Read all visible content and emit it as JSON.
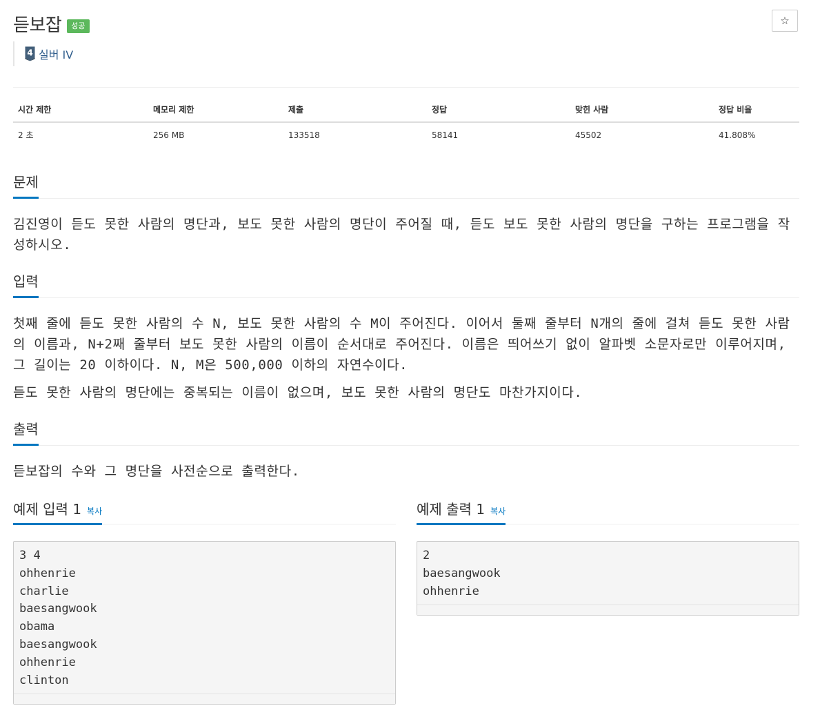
{
  "problem": {
    "title": "듣보잡",
    "status_badge": "성공",
    "tier_label": "실버 IV",
    "tier_number": "4"
  },
  "info_table": {
    "headers": [
      "시간 제한",
      "메모리 제한",
      "제출",
      "정답",
      "맞힌 사람",
      "정답 비율"
    ],
    "values": [
      "2 초",
      "256 MB",
      "133518",
      "58141",
      "45502",
      "41.808%"
    ]
  },
  "sections": {
    "problem": {
      "heading": "문제",
      "paragraphs": [
        "김진영이 듣도 못한 사람의 명단과, 보도 못한 사람의 명단이 주어질 때, 듣도 보도 못한 사람의 명단을 구하는 프로그램을 작성하시오."
      ]
    },
    "input": {
      "heading": "입력",
      "paragraphs": [
        "첫째 줄에 듣도 못한 사람의 수 N, 보도 못한 사람의 수 M이 주어진다. 이어서 둘째 줄부터 N개의 줄에 걸쳐 듣도 못한 사람의 이름과, N+2째 줄부터 보도 못한 사람의 이름이 순서대로 주어진다. 이름은 띄어쓰기 없이 알파벳 소문자로만 이루어지며, 그 길이는 20 이하이다. N, M은 500,000 이하의 자연수이다.",
        "듣도 못한 사람의 명단에는 중복되는 이름이 없으며, 보도 못한 사람의 명단도 마찬가지이다."
      ]
    },
    "output": {
      "heading": "출력",
      "paragraphs": [
        "듣보잡의 수와 그 명단을 사전순으로 출력한다."
      ]
    }
  },
  "samples": {
    "input": {
      "heading": "예제 입력 1",
      "copy_label": "복사",
      "lines": [
        "3 4",
        "ohhenrie",
        "charlie",
        "baesangwook",
        "obama",
        "baesangwook",
        "ohhenrie",
        "clinton"
      ]
    },
    "output": {
      "heading": "예제 출력 1",
      "copy_label": "복사",
      "lines": [
        "2",
        "baesangwook",
        "ohhenrie"
      ]
    }
  },
  "icons": {
    "star": "star-outline-icon",
    "tier": "silver-tier-icon"
  },
  "colors": {
    "accent": "#0076c0",
    "success_badge": "#5cb85c",
    "tier_text": "#2f5d8c"
  }
}
